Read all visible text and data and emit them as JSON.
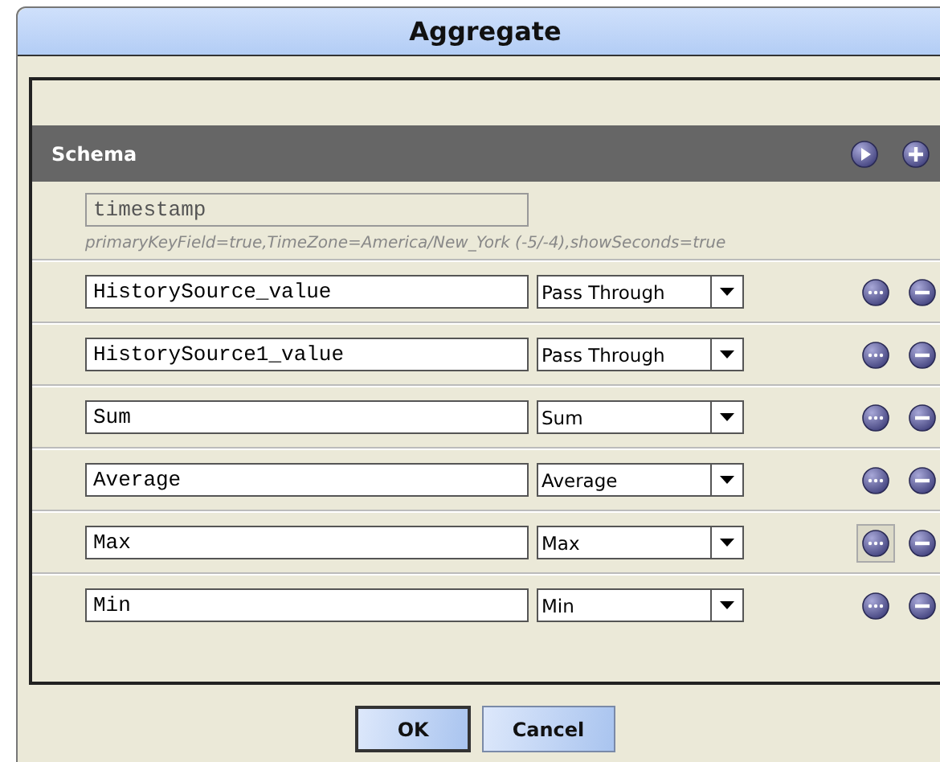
{
  "window": {
    "title": "Aggregate"
  },
  "schema": {
    "title": "Schema",
    "key_field": {
      "value": "timestamp",
      "disabled": true,
      "description": "primaryKeyField=true,TimeZone=America/New_York (-5/-4),showSeconds=true"
    },
    "rows": [
      {
        "name": "HistorySource_value",
        "function": "Pass Through",
        "highlighted": false
      },
      {
        "name": "HistorySource1_value",
        "function": "Pass Through",
        "highlighted": false
      },
      {
        "name": "Sum",
        "function": "Sum",
        "highlighted": false
      },
      {
        "name": "Average",
        "function": "Average",
        "highlighted": false
      },
      {
        "name": "Max",
        "function": "Max",
        "highlighted": true
      },
      {
        "name": "Min",
        "function": "Min",
        "highlighted": false
      }
    ]
  },
  "buttons": [
    {
      "label": "OK",
      "default": true
    },
    {
      "label": "Cancel",
      "default": false
    }
  ]
}
